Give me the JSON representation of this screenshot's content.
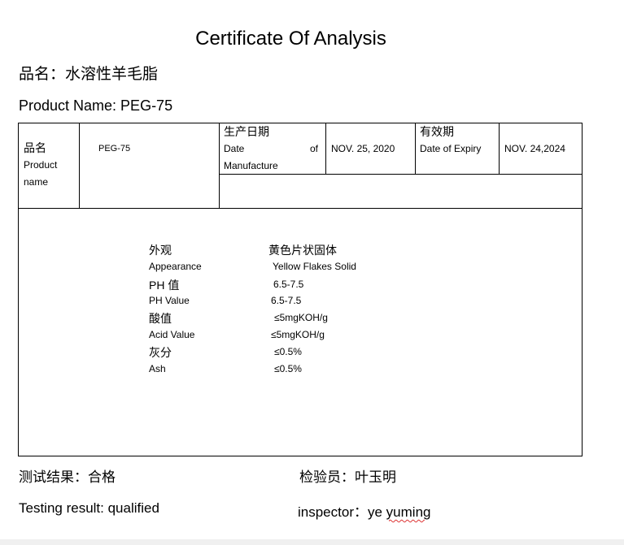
{
  "document": {
    "title": "Certificate Of Analysis",
    "cn_name_line": "品名：水溶性羊毛脂",
    "en_name_line": "Product Name:  PEG-75"
  },
  "table": {
    "name_label_cn": "品名",
    "name_label_en_1": "Product",
    "name_label_en_2": "name",
    "product_value": "PEG-75",
    "mfg_label_cn": "生产日期",
    "mfg_label_en_1": "Date",
    "mfg_label_en_of": "of",
    "mfg_label_en_2": "Manufacture",
    "mfg_value": "NOV. 25, 2020",
    "exp_label_cn": "有效期",
    "exp_label_en": "Date of Expiry",
    "exp_value": "NOV. 24,2024"
  },
  "properties": [
    {
      "label": "外观",
      "value": "黄色片状固体"
    },
    {
      "label": "Appearance",
      "value": "Yellow Flakes Solid"
    },
    {
      "label": "PH 值",
      "value": "6.5-7.5"
    },
    {
      "label": "PH Value",
      "value": "6.5-7.5"
    },
    {
      "label": "酸值",
      "value": "≤5mgKOH/g"
    },
    {
      "label": "Acid Value",
      "value": "≤5mgKOH/g"
    },
    {
      "label": "灰分",
      "value": "≤0.5%"
    },
    {
      "label": "Ash",
      "value": "≤0.5%"
    }
  ],
  "footer": {
    "result_cn": "测试结果：合格",
    "inspector_cn": "检验员：叶玉明",
    "result_en": "Testing result:  qualified",
    "inspector_en_label": "inspector：ye ",
    "inspector_en_name": "yuming"
  }
}
